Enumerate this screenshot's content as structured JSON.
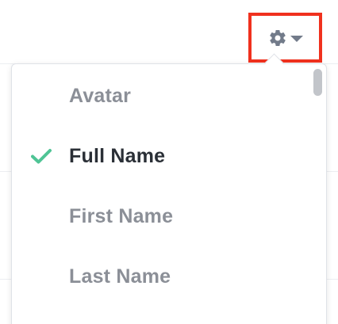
{
  "settings": {
    "gear_icon": "gear-icon",
    "caret_icon": "caret-down-icon",
    "highlight_color": "#f0311e"
  },
  "menu": {
    "items": [
      {
        "label": "Avatar",
        "selected": false
      },
      {
        "label": "Full Name",
        "selected": true
      },
      {
        "label": "First Name",
        "selected": false
      },
      {
        "label": "Last Name",
        "selected": false
      }
    ],
    "check_color": "#4fc495"
  }
}
